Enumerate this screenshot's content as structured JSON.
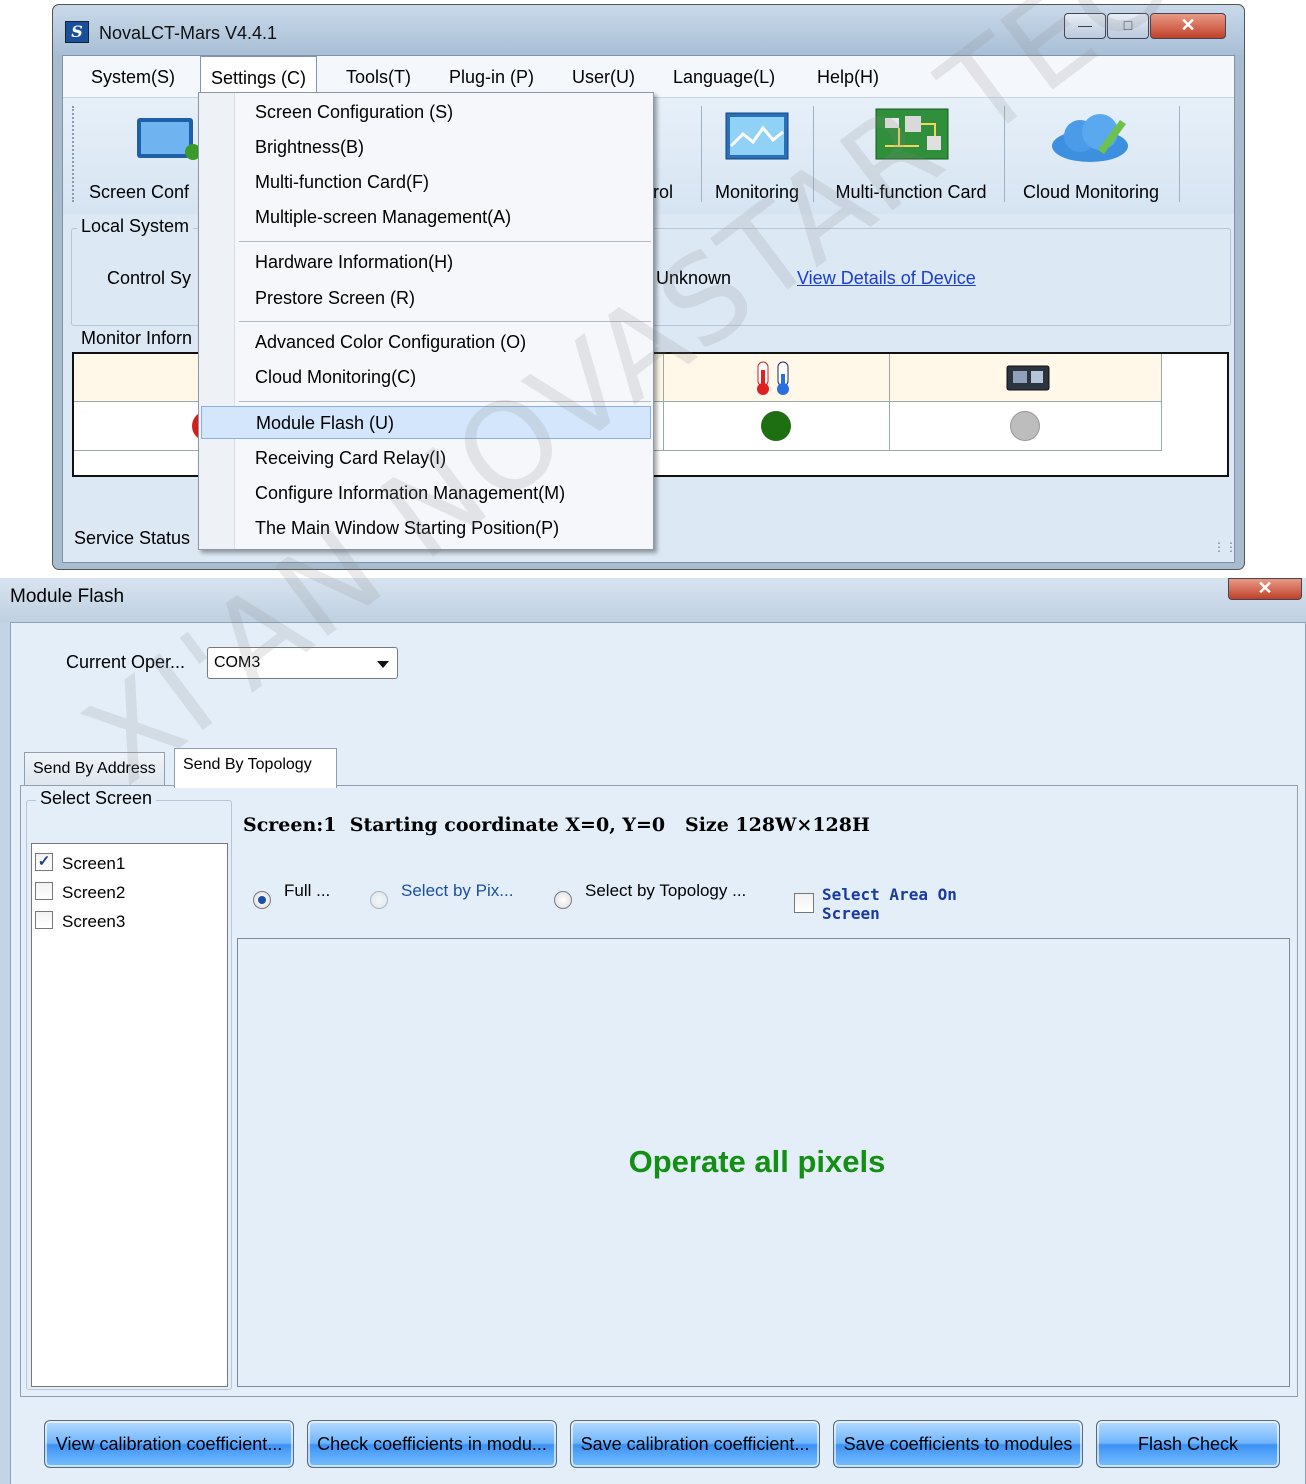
{
  "main_window": {
    "title": "NovaLCT-Mars V4.4.1",
    "menubar": [
      "System(S)",
      "Settings (C)",
      "Tools(T)",
      "Plug-in (P)",
      "User(U)",
      "Language(L)",
      "Help(H)"
    ],
    "toolbar": {
      "screen_config_label": "Screen Conf",
      "control_label": "rol",
      "monitoring_label": "Monitoring",
      "multifunction_label": "Multi-function Card",
      "cloud_label": "Cloud Monitoring"
    },
    "local_system": {
      "group_title": "Local System",
      "control_label": "Control Sy",
      "status_value": "Unknown",
      "details_link": "View Details of Device"
    },
    "monitor": {
      "group_title": "Monitor Inforn",
      "status_colors": {
        "red": "#d61e1e",
        "green": "#1e6e12",
        "gray": "#bdbdbd"
      }
    },
    "service_status": "Service Status"
  },
  "settings_menu": {
    "items": [
      "Screen Configuration (S)",
      "Brightness(B)",
      "Multi-function Card(F)",
      "Multiple-screen Management(A)",
      "Hardware Information(H)",
      "Prestore Screen (R)",
      "Advanced Color Configuration (O)",
      "Cloud Monitoring(C)",
      "Module Flash (U)",
      "Receiving Card Relay(I)",
      "Configure Information Management(M)",
      "The Main Window Starting Position(P)"
    ],
    "highlighted": "Module Flash (U)"
  },
  "module_flash": {
    "title": "Module Flash",
    "current_oper_label": "Current Oper...",
    "port_value": "COM3",
    "tabs": [
      "Send By Address",
      "Send By Topology"
    ],
    "select_screen_title": "Select Screen",
    "screens": [
      {
        "name": "Screen1",
        "checked": true
      },
      {
        "name": "Screen2",
        "checked": false
      },
      {
        "name": "Screen3",
        "checked": false
      }
    ],
    "screen_info": "Screen:1  Starting coordinate X=0, Y=0   Size 128W×128H",
    "options": {
      "full": "Full ...",
      "by_pixel": "Select by Pix...",
      "by_topology": "Select by Topology ...",
      "area_on_screen": "Select Area On Screen"
    },
    "canvas_message": "Operate all pixels",
    "buttons": [
      "View calibration coefficient...",
      "Check coefficients in modu...",
      "Save calibration coefficient...",
      "Save coefficients to modules",
      "Flash Check"
    ]
  },
  "watermark": "XI'AN NOVASTAR TECH CO., LTD"
}
